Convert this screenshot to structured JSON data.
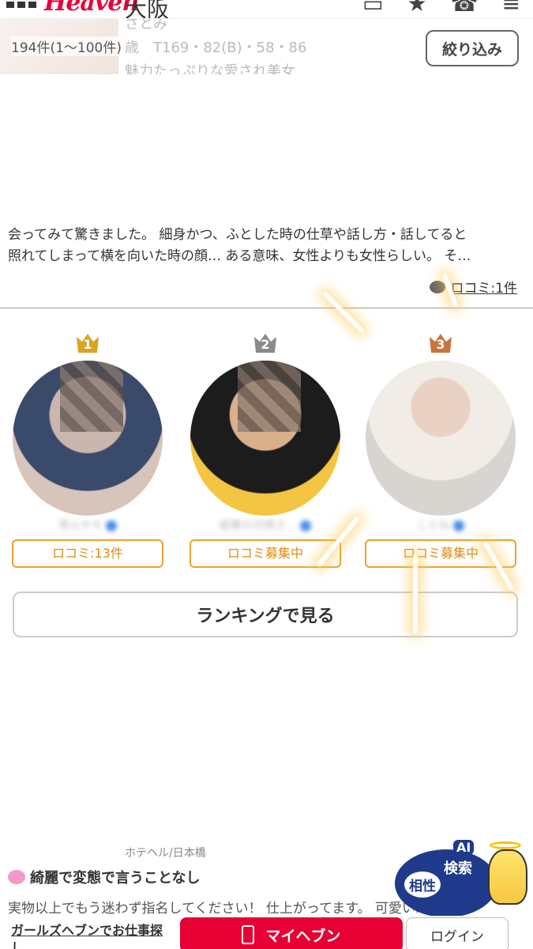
{
  "header": {
    "logo": "Heaven",
    "area": "大阪"
  },
  "prev_card": {
    "name": "さとみ",
    "spec": "歳　T169・82(B)・58・86",
    "catch": "魅力たっぷりな愛され美女"
  },
  "results": {
    "count": "194件(1〜100件)",
    "filter_label": "絞り込み"
  },
  "review": {
    "text_line1": "会ってみて驚きました。 細身かつ、ふとした時の仕草や話し方・話してると",
    "text_line2": "照れてしまって横を向いた時の顔… ある意味、女性よりも女性らしい。 そ…",
    "kuchikomi_link": "ロコミ:1件"
  },
  "ranking": {
    "items": [
      {
        "rank": "1",
        "crown_color": "#d9a520",
        "name": "青山サキ",
        "kc_label": "ロコミ:13件"
      },
      {
        "rank": "2",
        "crown_color": "#8a8a8a",
        "name": "姫華の可憐さ…",
        "kc_label": "ロコミ募集中"
      },
      {
        "rank": "3",
        "crown_color": "#c8743c",
        "name": "ことね",
        "kc_label": "ロコミ募集中"
      }
    ],
    "button_label": "ランキングで見る"
  },
  "lower_card": {
    "genre": "ホテヘル/日本橋",
    "title": "綺麗で変態で言うことなし",
    "text": "実物以上でもう迷わず指名してください！ 仕上がってます。 可愛い..."
  },
  "ai_badge": {
    "line1": "AI",
    "line2": "検索",
    "line3": "相性"
  },
  "bottom_bar": {
    "recruit_label": "ガールズヘブンでお仕事探し",
    "myheaven_label": "マイヘブン",
    "login_label": "ログイン"
  }
}
